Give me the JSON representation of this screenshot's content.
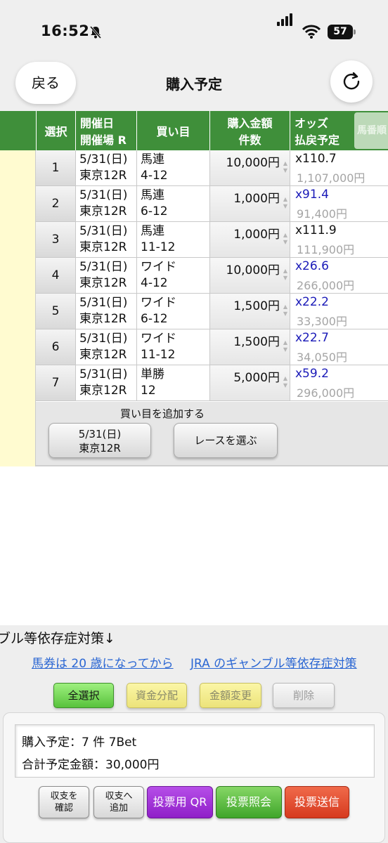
{
  "status_bar": {
    "time": "16:52",
    "battery": "57"
  },
  "header": {
    "back_label": "戻る",
    "title": "購入予定"
  },
  "columns": {
    "select": "選択",
    "date_line1": "開催日",
    "date_line2": "開催場 R",
    "bet": "買い目",
    "amount_line1": "購入金額",
    "amount_line2": "件数",
    "odds_line1": "オッズ",
    "odds_line2": "払戻予定",
    "sort_tab": "馬番順"
  },
  "rows": [
    {
      "num": "1",
      "date": "5/31(日)",
      "venue": "東京12R",
      "type": "馬連",
      "combo": "4-12",
      "amount": "10,000円",
      "odds": "x110.7",
      "odds_color": "#111111",
      "payout": "1,107,000円"
    },
    {
      "num": "2",
      "date": "5/31(日)",
      "venue": "東京12R",
      "type": "馬連",
      "combo": "6-12",
      "amount": "1,000円",
      "odds": "x91.4",
      "odds_color": "#1a1ab8",
      "payout": "91,400円"
    },
    {
      "num": "3",
      "date": "5/31(日)",
      "venue": "東京12R",
      "type": "馬連",
      "combo": "11-12",
      "amount": "1,000円",
      "odds": "x111.9",
      "odds_color": "#111111",
      "payout": "111,900円"
    },
    {
      "num": "4",
      "date": "5/31(日)",
      "venue": "東京12R",
      "type": "ワイド",
      "combo": "4-12",
      "amount": "10,000円",
      "odds": "x26.6",
      "odds_color": "#1a1ab8",
      "payout": "266,000円"
    },
    {
      "num": "5",
      "date": "5/31(日)",
      "venue": "東京12R",
      "type": "ワイド",
      "combo": "6-12",
      "amount": "1,500円",
      "odds": "x22.2",
      "odds_color": "#1a1ab8",
      "payout": "33,300円"
    },
    {
      "num": "6",
      "date": "5/31(日)",
      "venue": "東京12R",
      "type": "ワイド",
      "combo": "11-12",
      "amount": "1,500円",
      "odds": "x22.7",
      "odds_color": "#1a1ab8",
      "payout": "34,050円"
    },
    {
      "num": "7",
      "date": "5/31(日)",
      "venue": "東京12R",
      "type": "単勝",
      "combo": "12",
      "amount": "5,000円",
      "odds": "x59.2",
      "odds_color": "#1a1ab8",
      "payout": "296,000円"
    }
  ],
  "add_section": {
    "label": "買い目を追加する",
    "date_line1": "5/31(日)",
    "date_line2": "東京12R",
    "race_button": "レースを選ぶ"
  },
  "notice": "ブル等依存症対策↓",
  "links": {
    "age": "馬券は 20 歳になってから",
    "jra": "JRA のギャンブル等依存症対策"
  },
  "actions": {
    "select_all": "全選択",
    "fund_allocate": "資金分配",
    "change_amount": "金額変更",
    "delete": "削除"
  },
  "summary": {
    "planned": "購入予定：7 件 7Bet",
    "total": "合計予定金額：30,000円"
  },
  "bottom_buttons": {
    "confirm_line1": "収支を",
    "confirm_line2": "確認",
    "add_line1": "収支へ",
    "add_line2": "追加",
    "qr": "投票用 QR",
    "inquiry": "投票照会",
    "send": "投票送信"
  }
}
